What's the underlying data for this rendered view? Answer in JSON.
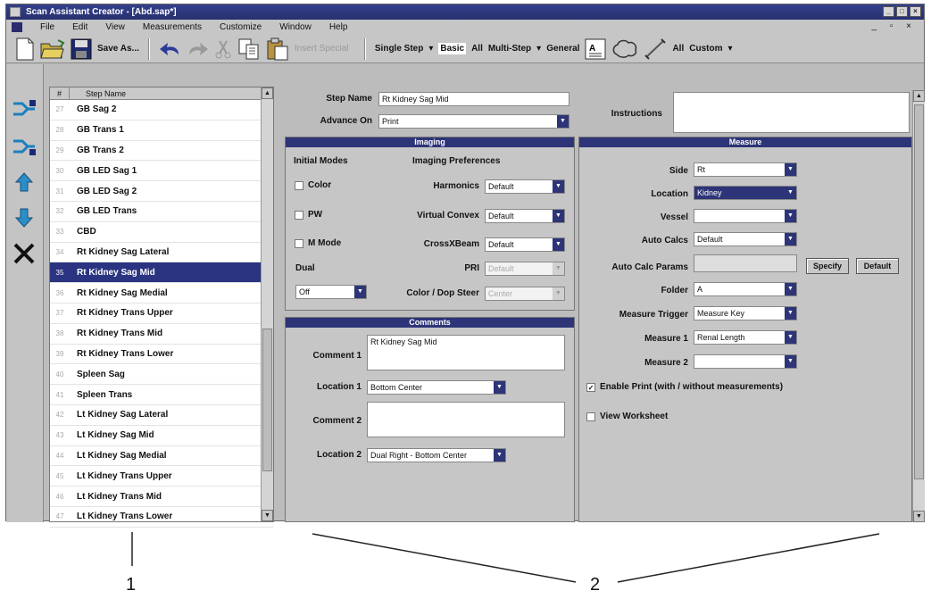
{
  "window": {
    "title": "Scan Assistant Creator - [Abd.sap*]",
    "controls": [
      "_",
      "□",
      "×"
    ]
  },
  "menu": [
    "File",
    "Edit",
    "View",
    "Measurements",
    "Customize",
    "Window",
    "Help"
  ],
  "menu_window_controls": "_ ▫ ×",
  "toolbar": {
    "save_as": "Save As...",
    "disabled_label": "Insert Special",
    "single_step": "Single Step",
    "basic": "Basic",
    "all": "All",
    "multi_step": "Multi-Step",
    "general": "General",
    "all2": "All",
    "custom": "Custom"
  },
  "step_list": {
    "header_num": "#",
    "header_name": "Step Name",
    "rows": [
      {
        "n": "27",
        "name": "GB Sag 2"
      },
      {
        "n": "28",
        "name": "GB Trans 1"
      },
      {
        "n": "29",
        "name": "GB Trans 2"
      },
      {
        "n": "30",
        "name": "GB LED Sag 1"
      },
      {
        "n": "31",
        "name": "GB LED Sag 2"
      },
      {
        "n": "32",
        "name": "GB LED Trans"
      },
      {
        "n": "33",
        "name": "CBD"
      },
      {
        "n": "34",
        "name": "Rt Kidney Sag Lateral"
      },
      {
        "n": "35",
        "name": "Rt Kidney Sag Mid"
      },
      {
        "n": "36",
        "name": "Rt Kidney Sag Medial"
      },
      {
        "n": "37",
        "name": "Rt Kidney Trans Upper"
      },
      {
        "n": "38",
        "name": "Rt Kidney Trans Mid"
      },
      {
        "n": "39",
        "name": "Rt Kidney Trans Lower"
      },
      {
        "n": "40",
        "name": "Spleen Sag"
      },
      {
        "n": "41",
        "name": "Spleen Trans"
      },
      {
        "n": "42",
        "name": "Lt Kidney Sag Lateral"
      },
      {
        "n": "43",
        "name": "Lt Kidney Sag Mid"
      },
      {
        "n": "44",
        "name": "Lt Kidney Sag Medial"
      },
      {
        "n": "45",
        "name": "Lt Kidney Trans Upper"
      },
      {
        "n": "46",
        "name": "Lt Kidney Trans Mid"
      },
      {
        "n": "47",
        "name": "Lt Kidney Trans Lower"
      }
    ],
    "selected_index": 8
  },
  "step": {
    "name_label": "Step Name",
    "name_value": "Rt Kidney Sag Mid",
    "advance_label": "Advance On",
    "advance_value": "Print",
    "instructions_label": "Instructions",
    "instructions_value": ""
  },
  "imaging": {
    "title": "Imaging",
    "initial_modes": "Initial Modes",
    "imaging_preferences": "Imaging Preferences",
    "color": "Color",
    "pw": "PW",
    "mmode": "M Mode",
    "dual": "Dual",
    "dual_value": "Off",
    "harmonics": "Harmonics",
    "harmonics_value": "Default",
    "virtual_convex": "Virtual Convex",
    "virtual_convex_value": "Default",
    "crossxbeam": "CrossXBeam",
    "crossxbeam_value": "Default",
    "pri": "PRI",
    "pri_value": "Default",
    "color_drop": "Color / Dop Steer",
    "color_drop_value": "Center"
  },
  "comments": {
    "title": "Comments",
    "c1_label": "Comment 1",
    "c1_value": "Rt Kidney Sag Mid",
    "loc1_label": "Location 1",
    "loc1_value": "Bottom Center",
    "c2_label": "Comment 2",
    "c2_value": "",
    "loc2_label": "Location 2",
    "loc2_value": "Dual Right - Bottom Center"
  },
  "measure": {
    "title": "Measure",
    "side": "Side",
    "side_value": "Rt",
    "location": "Location",
    "location_value": "Kidney",
    "vessel": "Vessel",
    "vessel_value": "",
    "auto_calcs": "Auto Calcs",
    "auto_calcs_value": "Default",
    "auto_calc_params": "Auto Calc Params",
    "auto_calc_params_value": "",
    "specify": "Specify",
    "default": "Default",
    "folder": "Folder",
    "folder_value": "A",
    "measure_trigger": "Measure Trigger",
    "measure_trigger_value": "Measure Key",
    "measure1": "Measure 1",
    "measure1_value": "Renal Length",
    "measure2": "Measure 2",
    "measure2_value": "",
    "enable_print": "Enable Print (with / without measurements)",
    "enable_print_checked": true,
    "view_worksheet": "View Worksheet",
    "view_worksheet_checked": false
  },
  "callouts": {
    "one": "1",
    "two": "2"
  },
  "colors": {
    "titlebar": "#2d3478",
    "selection": "#2a3480",
    "panel_bg": "#c6c6c6"
  }
}
